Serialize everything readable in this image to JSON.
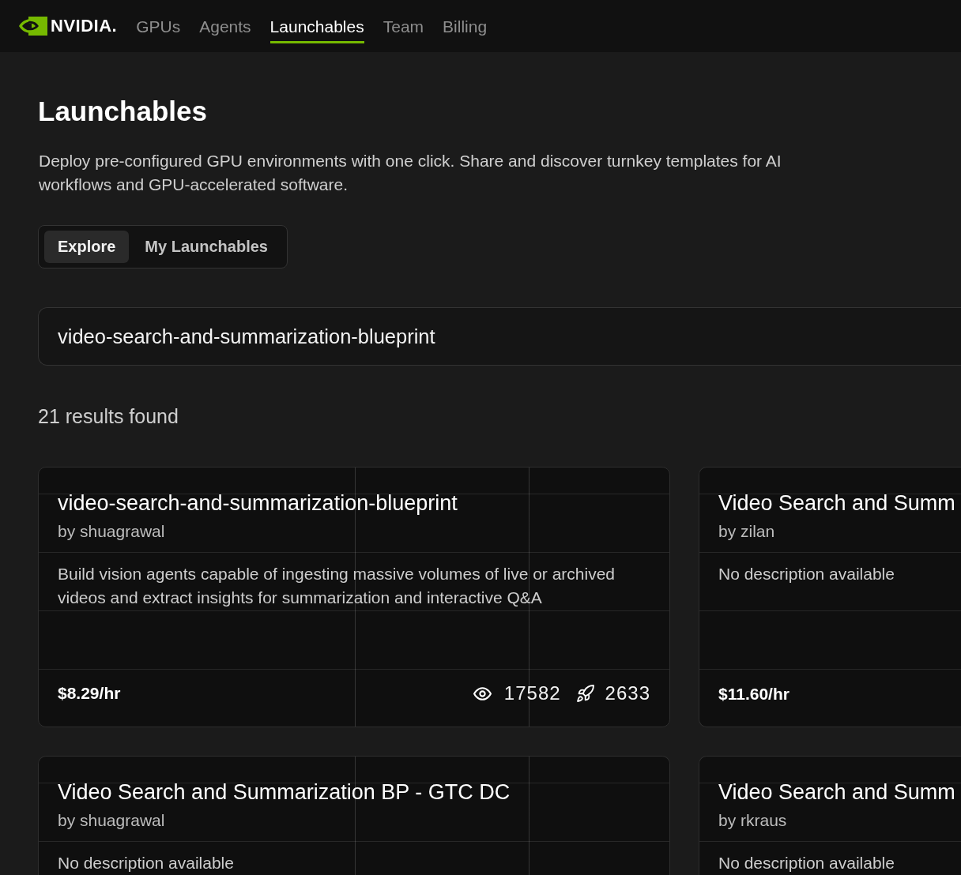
{
  "nav": {
    "logo": "NVIDIA.",
    "items": [
      {
        "label": "GPUs",
        "selected": false
      },
      {
        "label": "Agents",
        "selected": false
      },
      {
        "label": "Launchables",
        "selected": true
      },
      {
        "label": "Team",
        "selected": false
      },
      {
        "label": "Billing",
        "selected": false
      }
    ]
  },
  "page": {
    "title": "Launchables",
    "description": "Deploy pre-configured GPU environments with one click. Share and discover turnkey templates for AI workflows and GPU-accelerated software."
  },
  "view_tabs": [
    {
      "label": "Explore",
      "selected": true
    },
    {
      "label": "My Launchables",
      "selected": false
    }
  ],
  "search": {
    "value": "video-search-and-summarization-blueprint"
  },
  "results_count": "21 results found",
  "cards": [
    {
      "title": "video-search-and-summarization-blueprint",
      "author": "by shuagrawal",
      "description": "Build vision agents capable of ingesting massive volumes of live or archived videos and extract insights for summarization and interactive Q&A",
      "price": "$8.29/hr",
      "views": "17582",
      "deploys": "2633"
    },
    {
      "title": "Video Search and Summ",
      "author": "by zilan",
      "description": "No description available",
      "price": "$11.60/hr"
    },
    {
      "title": "Video Search and Summarization BP - GTC DC",
      "author": "by shuagrawal",
      "description": "No description available"
    },
    {
      "title": "Video Search and Summ",
      "author": "by rkraus",
      "description": "No description available"
    }
  ]
}
